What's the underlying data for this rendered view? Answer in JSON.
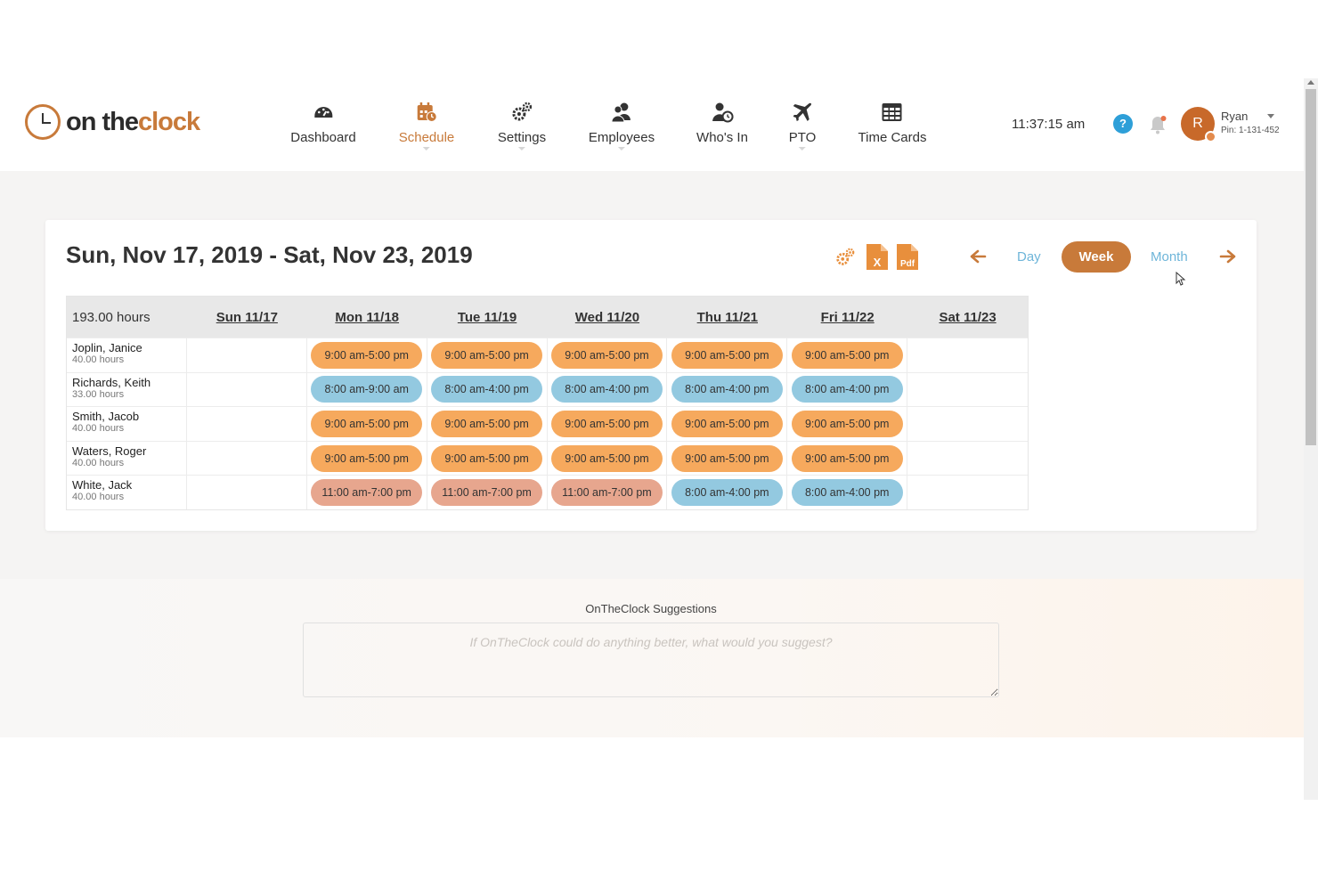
{
  "brand": {
    "name_part1": "on the",
    "name_part2": "clock",
    "accent_color": "#c87a3a"
  },
  "nav": [
    {
      "label": "Dashboard",
      "icon": "dashboard-gauge-icon",
      "active": false
    },
    {
      "label": "Schedule",
      "icon": "calendar-clock-icon",
      "active": true
    },
    {
      "label": "Settings",
      "icon": "gears-icon",
      "active": false
    },
    {
      "label": "Employees",
      "icon": "users-icon",
      "active": false
    },
    {
      "label": "Who's In",
      "icon": "user-clock-icon",
      "active": false
    },
    {
      "label": "PTO",
      "icon": "plane-icon",
      "active": false
    },
    {
      "label": "Time Cards",
      "icon": "table-icon",
      "active": false
    }
  ],
  "header": {
    "time": "11:37:15 am",
    "help": "?",
    "user": {
      "initial": "R",
      "name": "Ryan",
      "pin": "Pin: 1-131-452"
    }
  },
  "schedule": {
    "range_title": "Sun, Nov 17, 2019 - Sat, Nov 23, 2019",
    "views": {
      "day": "Day",
      "week": "Week",
      "month": "Month",
      "active": "Week"
    },
    "tools": {
      "excel_letter": "X",
      "pdf_label": "Pdf"
    },
    "total_hours": "193.00 hours",
    "days": [
      "Sun 11/17",
      "Mon 11/18",
      "Tue 11/19",
      "Wed 11/20",
      "Thu 11/21",
      "Fri 11/22",
      "Sat 11/23"
    ],
    "shift_colors": {
      "orange": "#f6a95d",
      "blue": "#93c9e0",
      "salmon": "#e7a68e"
    },
    "employees": [
      {
        "name": "Joplin, Janice",
        "hours": "40.00 hours",
        "shifts": [
          null,
          {
            "t": "9:00 am-5:00 pm",
            "c": "orange"
          },
          {
            "t": "9:00 am-5:00 pm",
            "c": "orange"
          },
          {
            "t": "9:00 am-5:00 pm",
            "c": "orange"
          },
          {
            "t": "9:00 am-5:00 pm",
            "c": "orange"
          },
          {
            "t": "9:00 am-5:00 pm",
            "c": "orange"
          },
          null
        ]
      },
      {
        "name": "Richards, Keith",
        "hours": "33.00 hours",
        "shifts": [
          null,
          {
            "t": "8:00 am-9:00 am",
            "c": "blue"
          },
          {
            "t": "8:00 am-4:00 pm",
            "c": "blue"
          },
          {
            "t": "8:00 am-4:00 pm",
            "c": "blue"
          },
          {
            "t": "8:00 am-4:00 pm",
            "c": "blue"
          },
          {
            "t": "8:00 am-4:00 pm",
            "c": "blue"
          },
          null
        ]
      },
      {
        "name": "Smith, Jacob",
        "hours": "40.00 hours",
        "shifts": [
          null,
          {
            "t": "9:00 am-5:00 pm",
            "c": "orange"
          },
          {
            "t": "9:00 am-5:00 pm",
            "c": "orange"
          },
          {
            "t": "9:00 am-5:00 pm",
            "c": "orange"
          },
          {
            "t": "9:00 am-5:00 pm",
            "c": "orange"
          },
          {
            "t": "9:00 am-5:00 pm",
            "c": "orange"
          },
          null
        ]
      },
      {
        "name": "Waters, Roger",
        "hours": "40.00 hours",
        "shifts": [
          null,
          {
            "t": "9:00 am-5:00 pm",
            "c": "orange"
          },
          {
            "t": "9:00 am-5:00 pm",
            "c": "orange"
          },
          {
            "t": "9:00 am-5:00 pm",
            "c": "orange"
          },
          {
            "t": "9:00 am-5:00 pm",
            "c": "orange"
          },
          {
            "t": "9:00 am-5:00 pm",
            "c": "orange"
          },
          null
        ]
      },
      {
        "name": "White, Jack",
        "hours": "40.00 hours",
        "shifts": [
          null,
          {
            "t": "11:00 am-7:00 pm",
            "c": "salmon"
          },
          {
            "t": "11:00 am-7:00 pm",
            "c": "salmon"
          },
          {
            "t": "11:00 am-7:00 pm",
            "c": "salmon"
          },
          {
            "t": "8:00 am-4:00 pm",
            "c": "blue"
          },
          {
            "t": "8:00 am-4:00 pm",
            "c": "blue"
          },
          null
        ]
      }
    ]
  },
  "suggestions": {
    "label": "OnTheClock Suggestions",
    "placeholder": "If OnTheClock could do anything better, what would you suggest?"
  }
}
